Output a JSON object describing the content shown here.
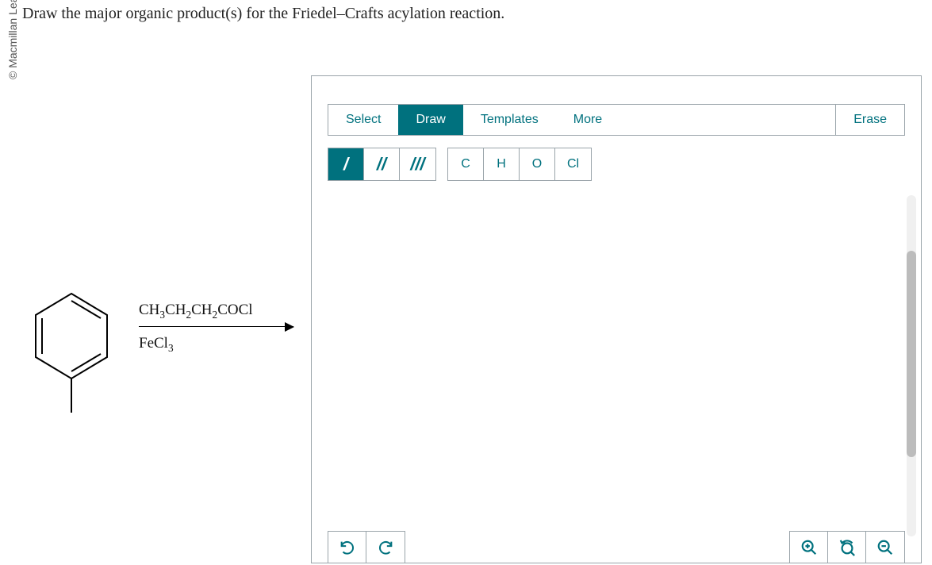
{
  "copyright": "© Macmillan Lea",
  "question": "Draw the major organic product(s) for the Friedel–Crafts acylation reaction.",
  "reaction": {
    "substrate": "toluene",
    "reagent_top_html": "CH<sub>3</sub>CH<sub>2</sub>CH<sub>2</sub>COCl",
    "catalyst_html": "FeCl<sub>3</sub>"
  },
  "editor": {
    "tabs": {
      "select": "Select",
      "draw": "Draw",
      "templates": "Templates",
      "more": "More",
      "erase": "Erase"
    },
    "active_tab": "draw",
    "bond_tools": {
      "single": "/",
      "double": "//",
      "triple": "///"
    },
    "active_bond": "single",
    "atoms": [
      "C",
      "H",
      "O",
      "Cl"
    ],
    "bottom": {
      "undo": "↺",
      "redo": "↻",
      "zoom_in": "⊕",
      "zoom_reset": "⟲",
      "zoom_out": "⊖"
    }
  }
}
